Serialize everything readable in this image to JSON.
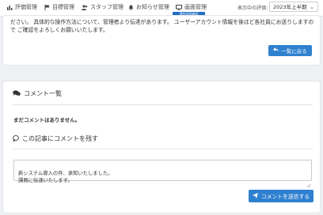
{
  "nav": {
    "items": [
      {
        "label": "評価管理",
        "icon": "bar-chart-icon"
      },
      {
        "label": "目標管理",
        "icon": "flag-icon"
      },
      {
        "label": "スタッフ管理",
        "icon": "users-icon"
      },
      {
        "label": "お知らせ管理",
        "icon": "bell-icon"
      },
      {
        "label": "画面管理",
        "icon": "monitor-icon"
      }
    ],
    "active_badge": "選択画面確認",
    "period_label": "表示中の評価：",
    "period_value": "2023年上半期"
  },
  "notice": {
    "text": "ださい。 具体的な操作方法について、管理者より伝達があります。 ユーザーアカウント情報を後ほど各社員にお送りしますので ご確認をよろしくお願いいたします。",
    "back_button": "一覧に戻る"
  },
  "comments": {
    "heading": "コメント一覧",
    "empty_text": "まだコメントはありません。",
    "form_heading": "この記事にコメントを残す",
    "input_value": "新システム導入の件、承知いたしました。\n課員に伝達いたします。",
    "submit_label": "コメントを送信する"
  },
  "colors": {
    "accent": "#2f80cf",
    "badge": "#1f6fc5"
  }
}
